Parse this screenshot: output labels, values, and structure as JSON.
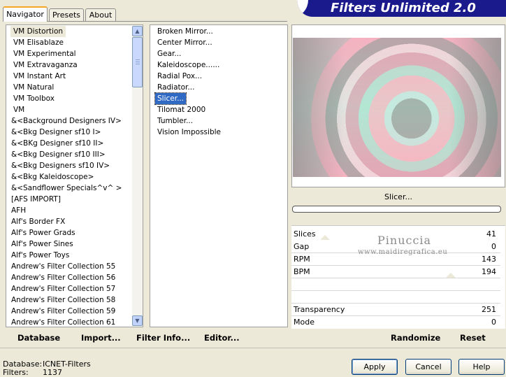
{
  "header": {
    "title": "Filters Unlimited 2.0"
  },
  "tabs": [
    {
      "label": "Navigator",
      "active": true
    },
    {
      "label": "Presets",
      "active": false
    },
    {
      "label": "About",
      "active": false
    }
  ],
  "categories": [
    "VM Distortion",
    "VM Elisablaze",
    "VM Experimental",
    "VM Extravaganza",
    "VM Instant Art",
    "VM Natural",
    "VM Toolbox",
    "VM",
    "&<Background Designers IV>",
    "&<Bkg Designer sf10 I>",
    "&<BKg Designer sf10 II>",
    "&<Bkg Designer sf10 III>",
    "&<Bkg Designers sf10 IV>",
    "&<Bkg Kaleidoscope>",
    "&<Sandflower Specials^v^ >",
    "[AFS IMPORT]",
    "AFH",
    "Alf's Border FX",
    "Alf's Power Grads",
    "Alf's Power Sines",
    "Alf's Power Toys",
    "Andrew's Filter Collection 55",
    "Andrew's Filter Collection 56",
    "Andrew's Filter Collection 57",
    "Andrew's Filter Collection 58",
    "Andrew's Filter Collection 59",
    "Andrew's Filter Collection 61"
  ],
  "filters": [
    "Broken Mirror...",
    "Center Mirror...",
    "Gear...",
    "Kaleidoscope......",
    "Radial Pox...",
    "Radiator...",
    "Slicer...",
    "Tilomat 2000",
    "Tumbler...",
    "Vision Impossible"
  ],
  "selected_filter": "Slicer...",
  "scrollbar": {
    "up_glyph": "▲",
    "down_glyph": "▼"
  },
  "params": {
    "slices": {
      "label": "Slices",
      "value": "41"
    },
    "gap": {
      "label": "Gap",
      "value": "0"
    },
    "rpm": {
      "label": "RPM",
      "value": "143"
    },
    "bpm": {
      "label": "BPM",
      "value": "194"
    },
    "transparency": {
      "label": "Transparency",
      "value": "251"
    },
    "mode": {
      "label": "Mode",
      "value": "0"
    }
  },
  "watermark": {
    "line1": "Pinuccia",
    "line2": "www.maidiregrafica.eu"
  },
  "toolbar": {
    "database": "Database",
    "import": "Import...",
    "filter_info": "Filter Info...",
    "editor": "Editor...",
    "randomize": "Randomize",
    "reset": "Reset"
  },
  "info": {
    "database_label": "Database:",
    "database_value": "ICNET-Filters",
    "filters_label": "Filters:",
    "filters_value": "1137"
  },
  "buttons": {
    "apply": "Apply",
    "cancel": "Cancel",
    "help": "Help"
  },
  "colors": {
    "banner": "#1a1a8c",
    "selection": "#316ac5",
    "tab_accent": "#f5a623"
  }
}
